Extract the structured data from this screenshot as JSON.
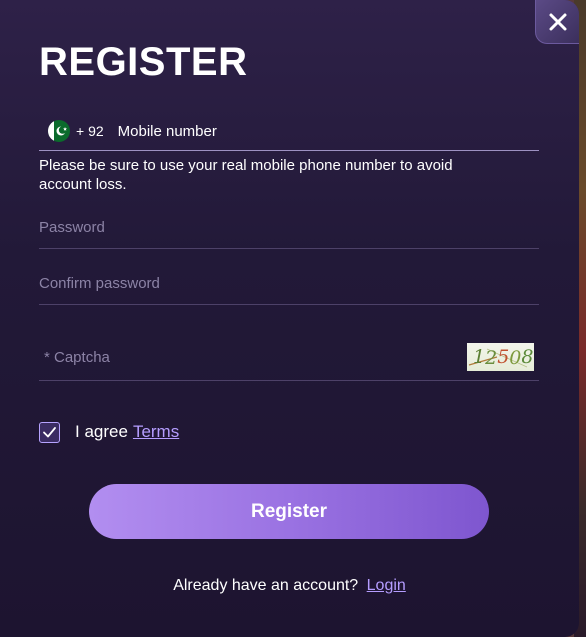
{
  "modal": {
    "title": "REGISTER",
    "close_icon": "close-icon"
  },
  "phone": {
    "flag_icon": "pakistan-flag-icon",
    "country_code": "+ 92",
    "placeholder": "Mobile number",
    "hint": "Please be sure to use your real mobile phone number to avoid account loss."
  },
  "password": {
    "placeholder": "Password"
  },
  "confirm_password": {
    "placeholder": "Confirm password"
  },
  "captcha": {
    "placeholder": "* Captcha",
    "code": "12508"
  },
  "agreement": {
    "checked": true,
    "check_icon": "checkmark-icon",
    "label": "I agree",
    "terms_link": "Terms"
  },
  "register_button": {
    "label": "Register"
  },
  "footer": {
    "text": "Already have an account?",
    "login_link": "Login"
  },
  "colors": {
    "accent": "#b59dff",
    "button_start": "#b28ef0",
    "button_end": "#7e56cf",
    "modal_bg": "#221938"
  }
}
